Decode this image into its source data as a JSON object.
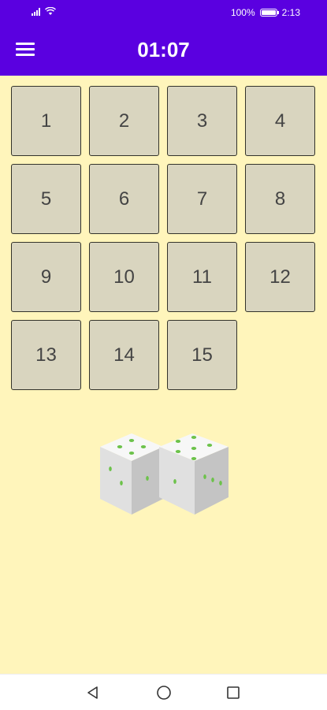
{
  "status": {
    "battery_percent": "100%",
    "time": "2:13",
    "battery_level": 1.0,
    "signal_icon": "signal-bars-icon",
    "wifi_icon": "wifi-icon"
  },
  "appbar": {
    "timer": "01:07",
    "menu_icon": "hamburger-menu-icon",
    "color": "#5A00E0"
  },
  "tiles": [
    "1",
    "2",
    "3",
    "4",
    "5",
    "6",
    "7",
    "8",
    "9",
    "10",
    "11",
    "12",
    "13",
    "14",
    "15",
    ""
  ],
  "colors": {
    "background": "#FFF5BB",
    "tile": "#D9D5BF",
    "tile_border": "#33332A",
    "die_pip": "#6CC24A"
  },
  "navigation": {
    "back_icon": "back-triangle-icon",
    "home_icon": "home-circle-icon",
    "recents_icon": "recents-square-icon"
  }
}
